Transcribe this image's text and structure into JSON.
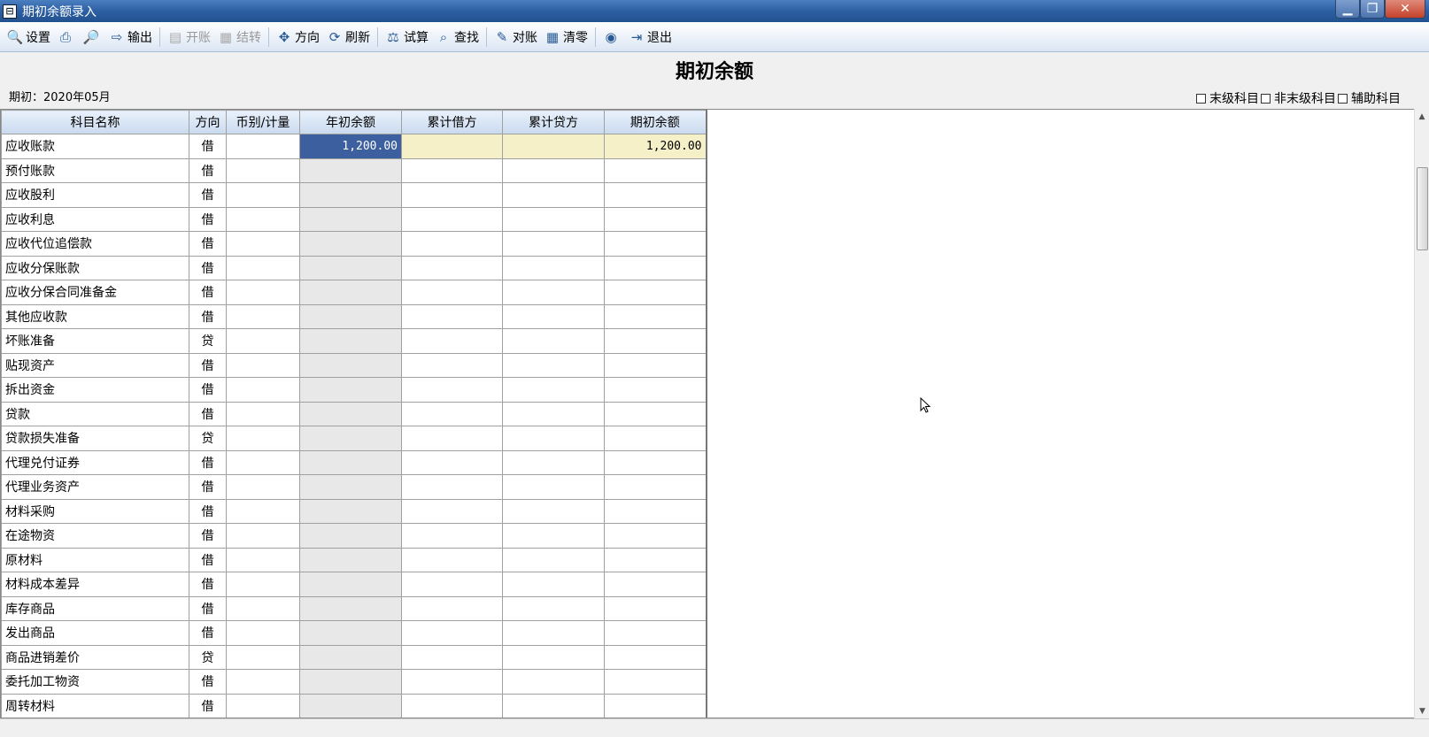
{
  "window": {
    "title": "期初余额录入",
    "app_icon": "app-window-icon"
  },
  "toolbar": {
    "items": [
      {
        "label": "设置",
        "icon": "search-settings-icon",
        "enabled": true
      },
      {
        "label": "",
        "icon": "print-icon",
        "enabled": true
      },
      {
        "label": "",
        "icon": "preview-icon",
        "enabled": true
      },
      {
        "label": "输出",
        "icon": "export-icon",
        "enabled": true
      },
      {
        "label": "开账",
        "icon": "open-account-icon",
        "enabled": false
      },
      {
        "label": "结转",
        "icon": "carry-forward-icon",
        "enabled": false
      },
      {
        "label": "方向",
        "icon": "direction-icon",
        "enabled": true
      },
      {
        "label": "刷新",
        "icon": "refresh-icon",
        "enabled": true
      },
      {
        "label": "试算",
        "icon": "balance-scale-icon",
        "enabled": true
      },
      {
        "label": "查找",
        "icon": "find-icon",
        "enabled": true
      },
      {
        "label": "对账",
        "icon": "reconcile-icon",
        "enabled": true
      },
      {
        "label": "清零",
        "icon": "clear-grid-icon",
        "enabled": true
      },
      {
        "label": "",
        "icon": "help-icon",
        "enabled": true
      },
      {
        "label": "退出",
        "icon": "exit-icon",
        "enabled": true
      }
    ]
  },
  "page": {
    "title": "期初余额",
    "period": "期初：2020年05月"
  },
  "legend": {
    "items": [
      "末级科目",
      "非末级科目",
      "辅助科目"
    ]
  },
  "table": {
    "headers": [
      "科目名称",
      "方向",
      "币别/计量",
      "年初余额",
      "累计借方",
      "累计贷方",
      "期初余额"
    ],
    "rows": [
      {
        "name": "应收账款",
        "dir": "借",
        "currency": "",
        "year_open": "1,200.00",
        "debit": "",
        "credit": "",
        "opening": "1,200.00",
        "selected": true
      },
      {
        "name": "预付账款",
        "dir": "借",
        "currency": "",
        "year_open": "",
        "debit": "",
        "credit": "",
        "opening": ""
      },
      {
        "name": "应收股利",
        "dir": "借",
        "currency": "",
        "year_open": "",
        "debit": "",
        "credit": "",
        "opening": ""
      },
      {
        "name": "应收利息",
        "dir": "借",
        "currency": "",
        "year_open": "",
        "debit": "",
        "credit": "",
        "opening": ""
      },
      {
        "name": "应收代位追偿款",
        "dir": "借",
        "currency": "",
        "year_open": "",
        "debit": "",
        "credit": "",
        "opening": ""
      },
      {
        "name": "应收分保账款",
        "dir": "借",
        "currency": "",
        "year_open": "",
        "debit": "",
        "credit": "",
        "opening": ""
      },
      {
        "name": "应收分保合同准备金",
        "dir": "借",
        "currency": "",
        "year_open": "",
        "debit": "",
        "credit": "",
        "opening": ""
      },
      {
        "name": "其他应收款",
        "dir": "借",
        "currency": "",
        "year_open": "",
        "debit": "",
        "credit": "",
        "opening": ""
      },
      {
        "name": "坏账准备",
        "dir": "贷",
        "currency": "",
        "year_open": "",
        "debit": "",
        "credit": "",
        "opening": ""
      },
      {
        "name": "贴现资产",
        "dir": "借",
        "currency": "",
        "year_open": "",
        "debit": "",
        "credit": "",
        "opening": ""
      },
      {
        "name": "拆出资金",
        "dir": "借",
        "currency": "",
        "year_open": "",
        "debit": "",
        "credit": "",
        "opening": ""
      },
      {
        "name": "贷款",
        "dir": "借",
        "currency": "",
        "year_open": "",
        "debit": "",
        "credit": "",
        "opening": ""
      },
      {
        "name": "贷款损失准备",
        "dir": "贷",
        "currency": "",
        "year_open": "",
        "debit": "",
        "credit": "",
        "opening": ""
      },
      {
        "name": "代理兑付证券",
        "dir": "借",
        "currency": "",
        "year_open": "",
        "debit": "",
        "credit": "",
        "opening": ""
      },
      {
        "name": "代理业务资产",
        "dir": "借",
        "currency": "",
        "year_open": "",
        "debit": "",
        "credit": "",
        "opening": ""
      },
      {
        "name": "材料采购",
        "dir": "借",
        "currency": "",
        "year_open": "",
        "debit": "",
        "credit": "",
        "opening": ""
      },
      {
        "name": "在途物资",
        "dir": "借",
        "currency": "",
        "year_open": "",
        "debit": "",
        "credit": "",
        "opening": ""
      },
      {
        "name": "原材料",
        "dir": "借",
        "currency": "",
        "year_open": "",
        "debit": "",
        "credit": "",
        "opening": ""
      },
      {
        "name": "材料成本差异",
        "dir": "借",
        "currency": "",
        "year_open": "",
        "debit": "",
        "credit": "",
        "opening": ""
      },
      {
        "name": "库存商品",
        "dir": "借",
        "currency": "",
        "year_open": "",
        "debit": "",
        "credit": "",
        "opening": ""
      },
      {
        "name": "发出商品",
        "dir": "借",
        "currency": "",
        "year_open": "",
        "debit": "",
        "credit": "",
        "opening": ""
      },
      {
        "name": "商品进销差价",
        "dir": "贷",
        "currency": "",
        "year_open": "",
        "debit": "",
        "credit": "",
        "opening": ""
      },
      {
        "name": "委托加工物资",
        "dir": "借",
        "currency": "",
        "year_open": "",
        "debit": "",
        "credit": "",
        "opening": ""
      },
      {
        "name": "周转材料",
        "dir": "借",
        "currency": "",
        "year_open": "",
        "debit": "",
        "credit": "",
        "opening": ""
      }
    ]
  },
  "colors": {
    "title_bar": "#2c5fa3",
    "selected_cell": "#3c5fa0",
    "highlight_cell": "#f5f0c8",
    "opening_column": "#e8e8e8"
  }
}
